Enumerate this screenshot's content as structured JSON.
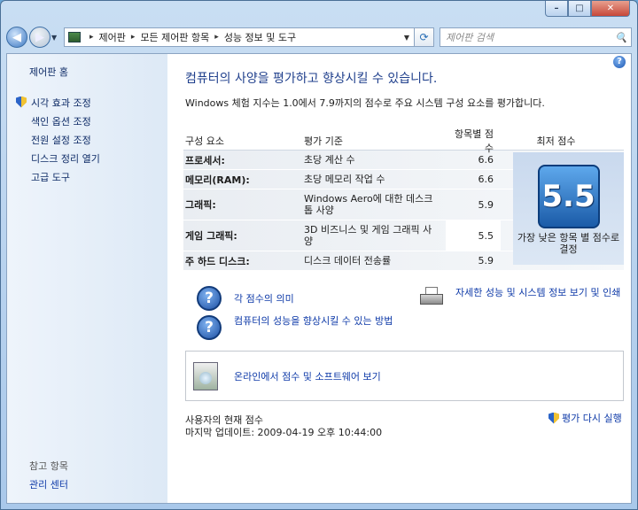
{
  "window": {
    "caption_buttons": [
      "minimize",
      "maximize",
      "close"
    ]
  },
  "navigation": {
    "back_icon": "back-arrow-icon",
    "forward_icon": "forward-arrow-icon",
    "breadcrumbs": [
      "제어판",
      "모든 제어판 항목",
      "성능 정보 및 도구"
    ],
    "search_placeholder": "제어판 검색"
  },
  "sidebar": {
    "home": "제어판 홈",
    "items": [
      {
        "label": "시각 효과 조정",
        "icon": "uac-shield-icon"
      },
      {
        "label": "색인 옵션 조정",
        "icon": ""
      },
      {
        "label": "전원 설정 조정",
        "icon": ""
      },
      {
        "label": "디스크 정리 열기",
        "icon": ""
      },
      {
        "label": "고급 도구",
        "icon": ""
      }
    ],
    "see_also": "참고 항목",
    "action_center": "관리 센터"
  },
  "main": {
    "title": "컴퓨터의 사양을 평가하고 향상시킬 수 있습니다.",
    "description": "Windows 체험 지수는 1.0에서 7.9까지의 점수로 주요 시스템 구성 요소를 평가합니다.",
    "table": {
      "headers": [
        "구성 요소",
        "평가 기준",
        "항목별 점수",
        "최저 점수"
      ],
      "rows": [
        {
          "component": "프로세서:",
          "criterion": "초당 계산 수",
          "score": "6.6"
        },
        {
          "component": "메모리(RAM):",
          "criterion": "초당 메모리 작업 수",
          "score": "6.6"
        },
        {
          "component": "그래픽:",
          "criterion": "Windows Aero에 대한 데스크톱 사양",
          "score": "5.9"
        },
        {
          "component": "게임 그래픽:",
          "criterion": "3D 비즈니스 및 게임 그래픽 사양",
          "score": "5.5"
        },
        {
          "component": "주 하드 디스크:",
          "criterion": "디스크 데이터 전송률",
          "score": "5.9"
        }
      ],
      "base_score": "5.5",
      "base_caption": "가장 낮은 항목 별 점수로 결정"
    },
    "links": {
      "score_meaning": "각 점수의 의미",
      "improve_performance": "컴퓨터의 성능을 향상시킬 수 있는 방법",
      "detailed_info": "자세한 성능 및 시스템 정보 보기 및 인쇄",
      "online_scores": "온라인에서 점수 및 소프트웨어 보기",
      "rerun": "평가 다시 실행"
    },
    "footer": {
      "current_score_label": "사용자의 현재 점수",
      "last_update": "마지막 업데이트: 2009-04-19 오후 10:44:00"
    }
  }
}
